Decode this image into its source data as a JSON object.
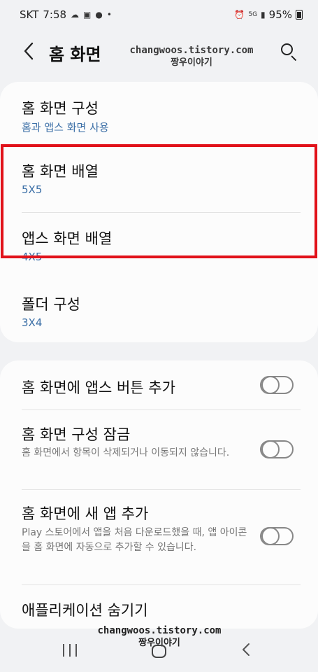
{
  "status_bar": {
    "carrier": "SKT",
    "time": "7:58",
    "network": "5G",
    "battery": "95%"
  },
  "header": {
    "title": "홈 화면"
  },
  "watermark": {
    "line1": "changwoos.tistory.com",
    "line2": "짱우이야기"
  },
  "settings_group1": {
    "items": [
      {
        "title": "홈 화면 구성",
        "value": "홈과 앱스 화면 사용"
      },
      {
        "title": "홈 화면 배열",
        "value": "5X5"
      },
      {
        "title": "앱스 화면 배열",
        "value": "4X5"
      },
      {
        "title": "폴더 구성",
        "value": "3X4"
      }
    ]
  },
  "settings_group2": {
    "items": [
      {
        "title": "홈 화면에 앱스 버튼 추가",
        "description": "",
        "enabled": false
      },
      {
        "title": "홈 화면 구성 잠금",
        "description": "홈 화면에서 항목이 삭제되거나 이동되지 않습니다.",
        "enabled": false
      },
      {
        "title": "홈 화면에 새 앱 추가",
        "description": "Play 스토어에서 앱을 처음 다운로드했을 때, 앱 아이콘을 홈 화면에 자동으로 추가할 수 있습니다.",
        "enabled": false
      },
      {
        "title": "애플리케이션 숨기기"
      }
    ]
  },
  "colors": {
    "accent_value": "#3a6ea6",
    "highlight_border": "#e1121a"
  },
  "icons": {
    "back": "chevron-left-icon",
    "search": "search-icon",
    "nav_recent": "recent-apps-icon",
    "nav_home": "home-icon",
    "nav_back": "back-icon"
  }
}
